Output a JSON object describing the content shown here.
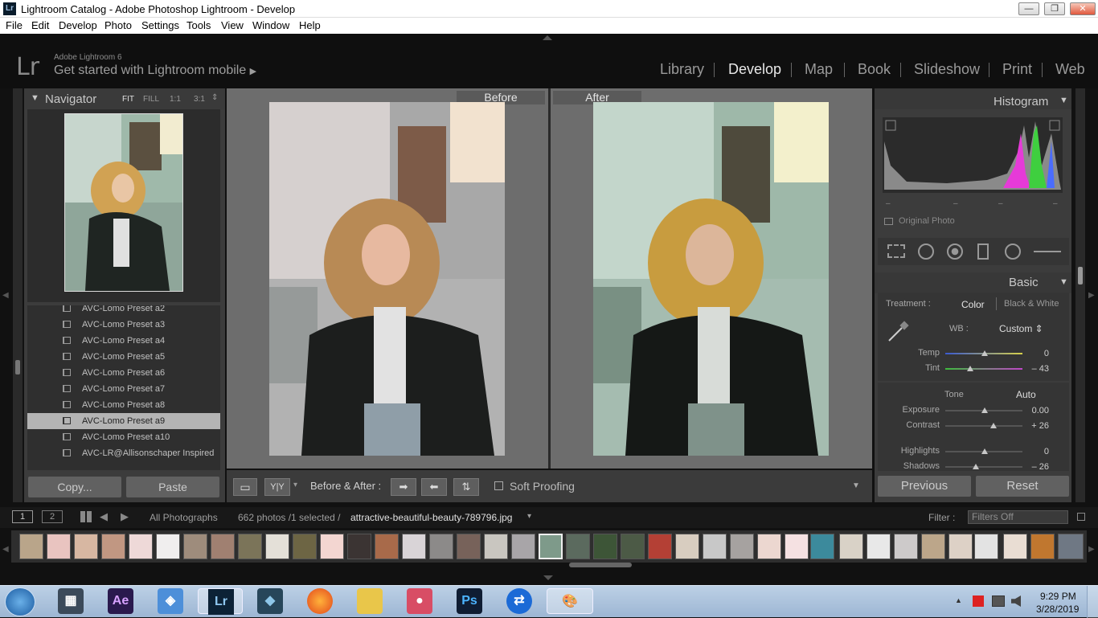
{
  "window": {
    "title": "Lightroom Catalog - Adobe Photoshop Lightroom - Develop",
    "app_icon": "Lr",
    "minimize": "—",
    "maximize": "❐",
    "close": "✕"
  },
  "menu": [
    "File",
    "Edit",
    "Develop",
    "Photo",
    "Settings",
    "Tools",
    "View",
    "Window",
    "Help"
  ],
  "identity": {
    "logo": "Lr",
    "product": "Adobe Lightroom 6",
    "mobile_prompt": "Get started with Lightroom mobile",
    "arrow": "▶"
  },
  "modules": [
    "Library",
    "Develop",
    "Map",
    "Book",
    "Slideshow",
    "Print",
    "Web"
  ],
  "active_module": "Develop",
  "navigator": {
    "title": "Navigator",
    "zoom_options": [
      "FIT",
      "FILL",
      "1:1",
      "3:1"
    ],
    "collapse_icon": "▼",
    "stepper": "⇕"
  },
  "presets": [
    "AVC-Lomo Preset a2",
    "AVC-Lomo Preset a3",
    "AVC-Lomo Preset a4",
    "AVC-Lomo Preset a5",
    "AVC-Lomo Preset a6",
    "AVC-Lomo Preset a7",
    "AVC-Lomo Preset a8",
    "AVC-Lomo Preset a9",
    "AVC-Lomo Preset a10",
    "AVC-LR@Allisonschaper Inspired"
  ],
  "selected_preset": "AVC-Lomo Preset a9",
  "left_buttons": {
    "copy": "Copy...",
    "paste": "Paste"
  },
  "compare": {
    "before": "Before",
    "after": "After"
  },
  "toolbar": {
    "view_icon": "▭",
    "yy_label": "Y|Y",
    "dropdown": "▾",
    "before_after": "Before & After :",
    "btn1": "➡",
    "btn2": "⬅",
    "btn3": "⇅",
    "soft_proofing": "Soft Proofing",
    "menu_arrow": "▼"
  },
  "histogram": {
    "title": "Histogram",
    "original_photo": "Original Photo",
    "collapse_icon": "▼",
    "dashes": [
      "–",
      "–",
      "–",
      "–"
    ]
  },
  "basic": {
    "title": "Basic",
    "treatment_label": "Treatment :",
    "treatment_color": "Color",
    "treatment_bw": "Black & White",
    "wb_label": "WB :",
    "wb_value": "Custom ⇕",
    "temp_label": "Temp",
    "temp_value": "0",
    "tint_label": "Tint",
    "tint_value": "– 43",
    "tone_label": "Tone",
    "auto_label": "Auto",
    "exposure_label": "Exposure",
    "exposure_value": "0.00",
    "contrast_label": "Contrast",
    "contrast_value": "+ 26",
    "highlights_label": "Highlights",
    "highlights_value": "0",
    "shadows_label": "Shadows",
    "shadows_value": "– 26"
  },
  "right_buttons": {
    "previous": "Previous",
    "reset": "Reset"
  },
  "filmbar": {
    "screen1": "1",
    "screen2": "2",
    "source": "All Photographs",
    "count": "662 photos /1 selected /",
    "filename": "attractive-beautiful-beauty-789796.jpg",
    "filter_label": "Filter :",
    "filter_value": "Filters Off"
  },
  "taskbar": {
    "time": "9:29 PM",
    "date": "3/28/2019",
    "apps": [
      "Ae",
      "Lr",
      "Ps"
    ]
  },
  "colors": {
    "accent_active": "#e8e8e8",
    "panel": "#3c3c3c",
    "background": "#111111",
    "selected_row": "#b4b4b4"
  },
  "icons": [
    "gear-icon",
    "crop-icon",
    "spot-removal-icon",
    "red-eye-icon",
    "graduated-filter-icon",
    "radial-filter-icon",
    "adjustment-brush-icon",
    "eyedropper-icon",
    "windows-start-icon",
    "firefox-icon",
    "folder-icon",
    "teamviewer-icon",
    "volume-icon",
    "flag-icon"
  ]
}
